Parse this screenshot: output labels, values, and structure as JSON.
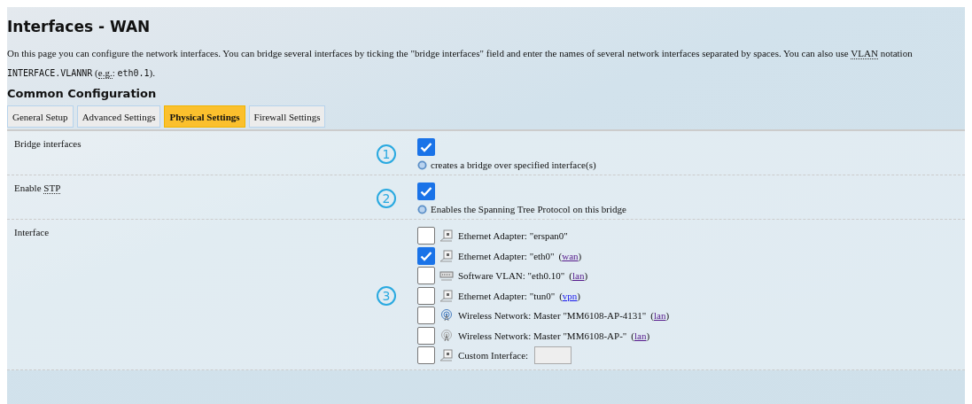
{
  "title": "Interfaces - WAN",
  "description": [
    [
      {
        "kind": "text",
        "text": "On this page you can configure the network interfaces. You can bridge several interfaces by ticking the \"bridge interfaces\" field and enter the names of several network interfaces separated by spaces. You can also use "
      },
      {
        "kind": "abbr",
        "text": "VLAN"
      },
      {
        "kind": "text",
        "text": " notation"
      }
    ],
    [
      {
        "kind": "code",
        "text": "INTERFACE.VLANNR"
      },
      {
        "kind": "text",
        "text": " ("
      },
      {
        "kind": "abbr",
        "text": "e.g."
      },
      {
        "kind": "text",
        "text": ": "
      },
      {
        "kind": "code",
        "text": "eth0.1"
      },
      {
        "kind": "text",
        "text": ")."
      }
    ]
  ],
  "section_title": "Common Configuration",
  "tabs": [
    {
      "label": "General Setup",
      "selected": false
    },
    {
      "label": "Advanced Settings",
      "selected": false
    },
    {
      "label": "Physical Settings",
      "selected": true
    },
    {
      "label": "Firewall Settings",
      "selected": false
    }
  ],
  "options": [
    {
      "label": "Bridge interfaces",
      "marker": "1",
      "kind": "checkbox",
      "checked": true,
      "hint": "creates a bridge over specified interface(s)"
    },
    {
      "label": "Enable",
      "abbr": "STP",
      "marker": "2",
      "kind": "checkbox",
      "checked": true,
      "hint": "Enables the Spanning Tree Protocol on this bridge"
    },
    {
      "label": "Interface",
      "marker": "3",
      "kind": "list",
      "items": [
        {
          "kind": "ethernet",
          "label": "Ethernet Adapter: \"erspan0\"",
          "checked": false
        },
        {
          "kind": "ethernet",
          "label": "Ethernet Adapter: \"eth0\"",
          "network": {
            "open": "(",
            "link": "wan",
            "close": ")"
          },
          "checked": true
        },
        {
          "kind": "vlan",
          "label": "Software VLAN: \"eth0.10\"",
          "network": {
            "open": "(",
            "link": "lan",
            "close": ")"
          },
          "checked": false
        },
        {
          "kind": "ethernet",
          "label": "Ethernet Adapter: \"tun0\"",
          "network": {
            "open": "(",
            "link": "vpn",
            "close": ")"
          },
          "checked": false
        },
        {
          "kind": "wireless",
          "label": "Wireless Network: Master \"MM6108-AP-4131\"",
          "network": {
            "open": "(",
            "link": "lan",
            "close": ")"
          },
          "checked": false
        },
        {
          "kind": "wireless-off",
          "label": "Wireless Network: Master \"MM6108-AP-\"",
          "network": {
            "open": "(",
            "link": "lan",
            "close": ")"
          },
          "checked": false
        },
        {
          "kind": "custom",
          "label": "Custom Interface:",
          "checked": false
        }
      ]
    }
  ]
}
